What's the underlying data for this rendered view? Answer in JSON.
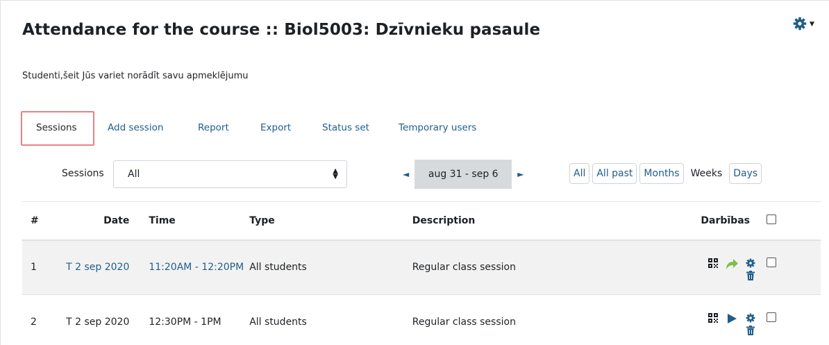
{
  "header": {
    "title": "Attendance for the course :: Biol5003: Dzīvnieku pasaule",
    "subtitle": "Studenti,šeit Jūs variet norādīt savu apmeklējumu",
    "settings_icon": "gear-icon"
  },
  "tabs": [
    {
      "label": "Sessions",
      "active": true
    },
    {
      "label": "Add session",
      "active": false
    },
    {
      "label": "Report",
      "active": false
    },
    {
      "label": "Export",
      "active": false
    },
    {
      "label": "Status set",
      "active": false
    },
    {
      "label": "Temporary users",
      "active": false
    }
  ],
  "filter": {
    "label": "Sessions",
    "selected": "All"
  },
  "week_nav": {
    "range": "aug 31 - sep 6"
  },
  "view_buttons": {
    "all": "All",
    "all_past": "All past",
    "months": "Months",
    "weeks": "Weeks",
    "days": "Days"
  },
  "table": {
    "headers": {
      "num": "#",
      "date": "Date",
      "time": "Time",
      "type": "Type",
      "description": "Description",
      "actions": "Darbības"
    },
    "rows": [
      {
        "num": "1",
        "date": "T 2 sep 2020",
        "time": "11:20AM - 12:20PM",
        "type": "All students",
        "description": "Regular class session",
        "linked": true,
        "status_icon": "take-attendance-arrow-icon"
      },
      {
        "num": "2",
        "date": "T 2 sep 2020",
        "time": "12:30PM - 1PM",
        "type": "All students",
        "description": "Regular class session",
        "linked": false,
        "status_icon": "play-icon"
      }
    ]
  },
  "colors": {
    "link": "#1f5d8a",
    "highlight_border": "#ec8080",
    "week_box": "#d7dadd",
    "green_arrow": "#7cc14a"
  }
}
